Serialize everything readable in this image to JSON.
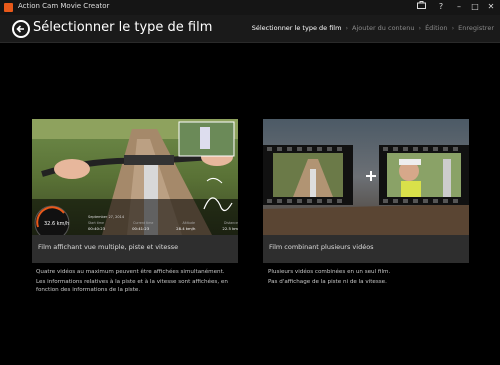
{
  "window": {
    "title": "Action Cam Movie Creator",
    "controls": [
      "toolbox-icon",
      "help-icon",
      "minimize-icon",
      "maximize-icon",
      "close-icon"
    ]
  },
  "header": {
    "page_title": "Sélectionner le type de film",
    "steps": [
      {
        "label": "Sélectionner le type de film",
        "active": true
      },
      {
        "label": "Ajouter du contenu",
        "active": false
      },
      {
        "label": "Édition",
        "active": false
      },
      {
        "label": "Enregistrer",
        "active": false
      }
    ]
  },
  "cards": [
    {
      "caption": "Film affichant vue multiple, piste et vitesse",
      "overlay": {
        "speed": "32.6 km/h",
        "date": "September 27, 2014",
        "labels": [
          "Start time",
          "Current time",
          "Altitude",
          "Distance"
        ],
        "values": [
          "00:40:23",
          "00:41:23",
          "28.4 km/h",
          "22.5 km"
        ]
      },
      "description": [
        "Quatre vidéos au maximum peuvent être affichées simultanément.",
        "Les informations relatives à la piste et à la vitesse sont affichées, en fonction des informations de la piste."
      ]
    },
    {
      "caption": "Film combinant plusieurs vidéos",
      "description": [
        "Plusieurs vidéos combinées en un seul film.",
        "Pas d'affichage de la piste ni de la vitesse."
      ]
    }
  ],
  "colors": {
    "accent": "#e8591a",
    "background": "#000000",
    "card": "#2e2e2e"
  }
}
